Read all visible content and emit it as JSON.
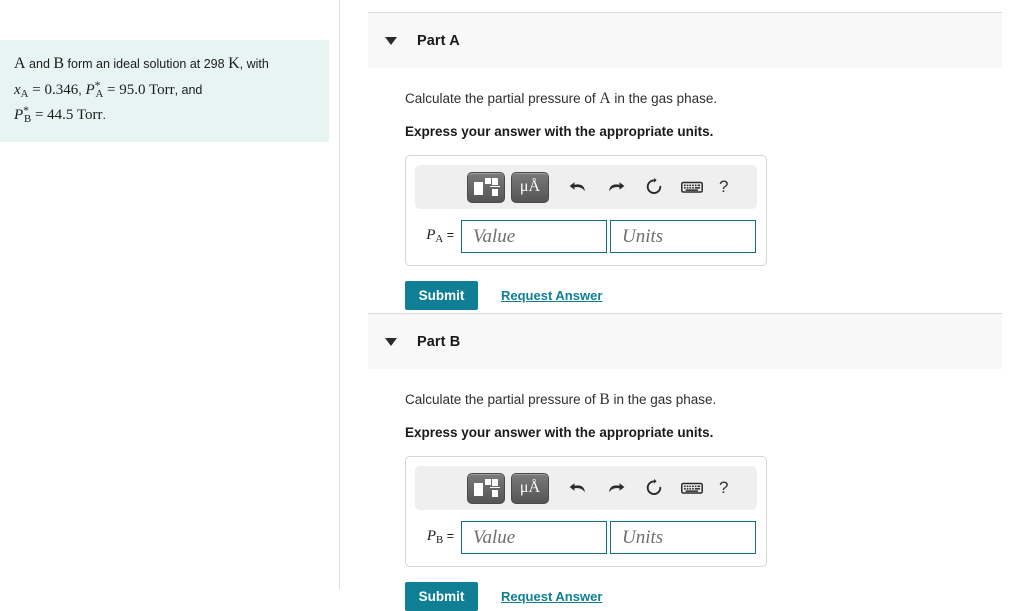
{
  "problem": {
    "line1_a": "A",
    "line1_b": "and",
    "line1_c": "B",
    "line1_d": "form an ideal solution at 298",
    "line1_e": "K",
    "line1_f": ", with",
    "line2_x": "x",
    "line2_x_sub": "A",
    "line2_eq1": "= 0.346",
    "line2_comma": ",",
    "line2_p": "P",
    "line2_p_sub": "A",
    "line2_p_sup": "*",
    "line2_eq2": "= 95.0 Torr",
    "line2_and": ", and",
    "line3_p": "P",
    "line3_p_sub": "B",
    "line3_p_sup": "*",
    "line3_eq": "= 44.5 Torr",
    "line3_period": "."
  },
  "colors": {
    "accent_teal": "#0f7f96",
    "field_border": "#11707f",
    "problem_bg": "#e7f4f2",
    "header_bg": "#f8f8f8",
    "toolbar_bg": "#efefef",
    "tool_button": "#555555"
  },
  "toolbar": {
    "template_icon": "math-template-icon",
    "units_label": "μÅ",
    "undo_icon": "undo-arrow-icon",
    "redo_icon": "redo-arrow-icon",
    "reset_icon": "reset-circular-arrow-icon",
    "keyboard_icon": "keyboard-icon",
    "help_label": "?"
  },
  "parts": [
    {
      "id": "A",
      "title": "Part A",
      "caret": "caret-down-icon",
      "question": "Calculate the partial pressure of",
      "question_symbol": "A",
      "question_tail": "in the gas phase.",
      "instruction": "Express your answer with the appropriate units.",
      "variable": "P",
      "variable_sub": "A",
      "equals": "=",
      "value_placeholder": "Value",
      "units_placeholder": "Units",
      "value_current": "",
      "units_current": "",
      "submit_label": "Submit",
      "request_label": "Request Answer"
    },
    {
      "id": "B",
      "title": "Part B",
      "caret": "caret-down-icon",
      "question": "Calculate the partial pressure of",
      "question_symbol": "B",
      "question_tail": "in the gas phase.",
      "instruction": "Express your answer with the appropriate units.",
      "variable": "P",
      "variable_sub": "B",
      "equals": "=",
      "value_placeholder": "Value",
      "units_placeholder": "Units",
      "value_current": "",
      "units_current": "",
      "submit_label": "Submit",
      "request_label": "Request Answer"
    }
  ]
}
